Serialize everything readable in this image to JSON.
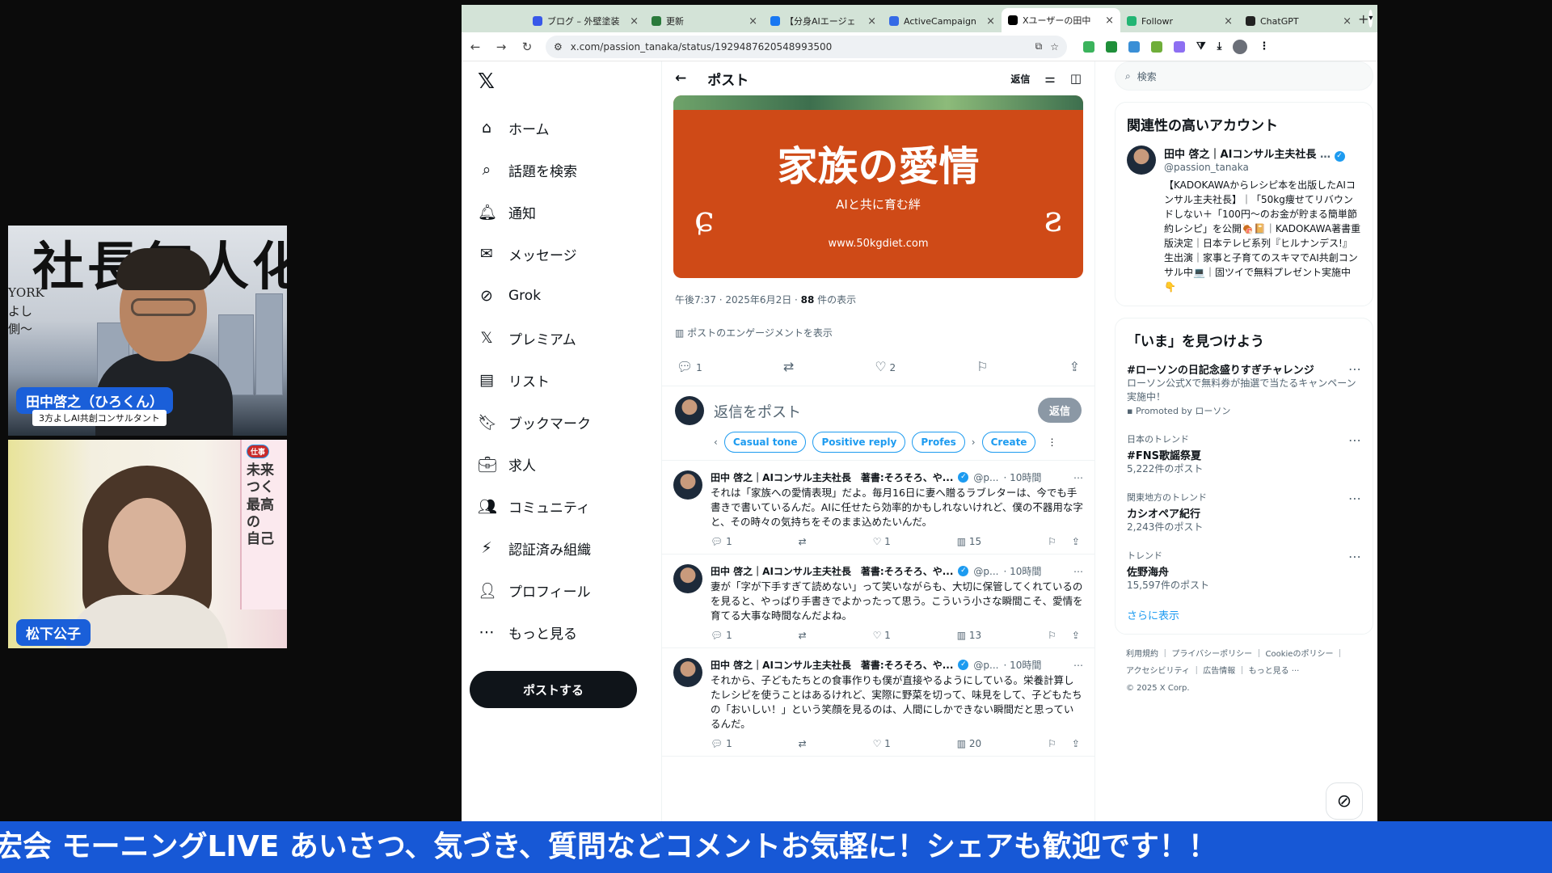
{
  "cam1": {
    "bg_text": "社長無人化",
    "side_text": "YORK\nよし\n側〜",
    "name": "田中啓之（ひろくん）",
    "subtitle": "3方よしAI共創コンサルタント"
  },
  "cam2": {
    "name": "松下公子",
    "book_chip": "仕事",
    "book_text": "未来\nつく\n最高の\n自己"
  },
  "browser": {
    "tabs": [
      {
        "title": "ブログ – 外壁塗装",
        "color": "#3858e9",
        "active": false
      },
      {
        "title": "更新",
        "color": "#2a7a3b",
        "active": false
      },
      {
        "title": "【分身AIエージェ",
        "color": "#1877f2",
        "active": false
      },
      {
        "title": "ActiveCampaign",
        "color": "#356ae6",
        "active": false
      },
      {
        "title": "Xユーザーの田中",
        "color": "#000000",
        "active": true
      },
      {
        "title": "Followr",
        "color": "#22b573",
        "active": false
      },
      {
        "title": "ChatGPT",
        "color": "#222222",
        "active": false
      }
    ],
    "new_tab": "+",
    "url": "x.com/passion_tanaka/status/1929487620548993500"
  },
  "nav": {
    "logo": "𝕏",
    "items": [
      {
        "label": "ホーム",
        "icon": "⌂",
        "key": "home"
      },
      {
        "label": "話題を検索",
        "icon": "⌕",
        "key": "explore"
      },
      {
        "label": "通知",
        "icon": "🔔︎",
        "key": "notifications"
      },
      {
        "label": "メッセージ",
        "icon": "✉",
        "key": "messages"
      },
      {
        "label": "Grok",
        "icon": "⊘",
        "key": "grok"
      },
      {
        "label": "プレミアム",
        "icon": "𝕏",
        "key": "premium"
      },
      {
        "label": "リスト",
        "icon": "▤",
        "key": "lists"
      },
      {
        "label": "ブックマーク",
        "icon": "🔖︎",
        "key": "bookmarks"
      },
      {
        "label": "求人",
        "icon": "💼︎",
        "key": "jobs"
      },
      {
        "label": "コミュニティ",
        "icon": "👥︎",
        "key": "communities"
      },
      {
        "label": "認証済み組織",
        "icon": "⚡︎",
        "key": "verified-orgs"
      },
      {
        "label": "プロフィール",
        "icon": "👤︎",
        "key": "profile"
      },
      {
        "label": "もっと見る",
        "icon": "⋯",
        "key": "more"
      }
    ],
    "post_button": "ポストする"
  },
  "main": {
    "header_title": "ポスト",
    "header_reply": "返信",
    "hero": {
      "title": "家族の愛情",
      "subtitle": "AIと共に育む絆",
      "url": "www.50kgdiet.com"
    },
    "meta_time": "午後7:37 · 2025年6月2日 · ",
    "meta_views": "88",
    "meta_views_label": " 件の表示",
    "engagement_link": "ポストのエンゲージメントを表示",
    "actions": {
      "replies": "1",
      "likes": "2"
    },
    "reply_placeholder": "返信をポスト",
    "reply_button": "返信",
    "chips": [
      "Casual tone",
      "Positive reply",
      "Profes",
      "Create"
    ],
    "replies": [
      {
        "name": "田中 啓之｜AIコンサル主夫社長　著書:そろそろ、や...",
        "handle": "@p...",
        "time": "· 10時間",
        "text": "それは「家族への愛情表現」だよ。毎月16日に妻へ贈るラブレターは、今でも手書きで書いているんだ。AIに任せたら効率的かもしれないけれど、僕の不器用な字と、その時々の気持ちをそのまま込めたいんだ。",
        "replies": "1",
        "likes": "1",
        "views": "15"
      },
      {
        "name": "田中 啓之｜AIコンサル主夫社長　著書:そろそろ、や...",
        "handle": "@p...",
        "time": "· 10時間",
        "text": "妻が「字が下手すぎて読めない」って笑いながらも、大切に保管してくれているのを見ると、やっぱり手書きでよかったって思う。こういう小さな瞬間こそ、愛情を育てる大事な時間なんだよね。",
        "replies": "1",
        "likes": "1",
        "views": "13"
      },
      {
        "name": "田中 啓之｜AIコンサル主夫社長　著書:そろそろ、や...",
        "handle": "@p...",
        "time": "· 10時間",
        "text": "それから、子どもたちとの食事作りも僕が直接やるようにしている。栄養計算したレシピを使うことはあるけれど、実際に野菜を切って、味見をして、子どもたちの「おいしい！」という笑顔を見るのは、人間にしかできない瞬間だと思っているんだ。",
        "replies": "1",
        "likes": "1",
        "views": "20"
      }
    ]
  },
  "right": {
    "search_placeholder": "検索",
    "related_title": "関連性の高いアカウント",
    "account": {
      "name": "田中 啓之｜AIコンサル主夫社長",
      "handle": "@passion_tanaka",
      "bio": "【KADOKAWAからレシピ本を出版したAIコンサル主夫社長】｜「50kg痩せてリバウンドしない＋「100円〜のお金が貯まる簡単節約レシピ」を公開🍖📔｜KADOKAWA著書重版決定｜日本テレビ系列『ヒルナンデス!』生出演｜家事と子育てのスキマでAI共創コンサル中💻｜固ツイで無料プレゼント実施中👇"
    },
    "trends_title": "「いま」を見つけよう",
    "trends": [
      {
        "context": "",
        "title": "#ローソンの日記念盛りすぎチャレンジ",
        "sub": "ローソン公式Xで無料券が抽選で当たるキャンペーン実施中！",
        "promo": "Promoted by ローソン"
      },
      {
        "context": "日本のトレンド",
        "title": "#FNS歌謡祭夏",
        "sub": "5,222件のポスト",
        "promo": ""
      },
      {
        "context": "関東地方のトレンド",
        "title": "カシオペア紀行",
        "sub": "2,243件のポスト",
        "promo": ""
      },
      {
        "context": "トレンド",
        "title": "佐野海舟",
        "sub": "15,597件のポスト",
        "promo": ""
      }
    ],
    "show_more": "さらに表示",
    "footer": "利用規約 ｜ プライバシーポリシー ｜ Cookieのポリシー ｜\nアクセシビリティ ｜ 広告情報 ｜ もっと見る ···\n© 2025 X Corp."
  },
  "ticker": "宏会 モーニングLIVE あいさつ、気づき、質問などコメントお気軽に！シェアも歓迎です！！",
  "colors": {
    "accent": "#1d9bf0",
    "ticker_bg": "#1758d6",
    "hero_bg": "#cf4a17",
    "tabbar_bg": "#d3e3d7"
  }
}
